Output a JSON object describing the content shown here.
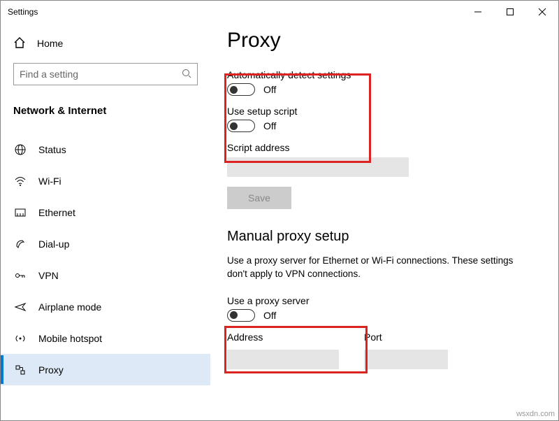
{
  "window": {
    "title": "Settings"
  },
  "sidebar": {
    "home_label": "Home",
    "search_placeholder": "Find a setting",
    "category": "Network & Internet",
    "items": [
      {
        "label": "Status"
      },
      {
        "label": "Wi-Fi"
      },
      {
        "label": "Ethernet"
      },
      {
        "label": "Dial-up"
      },
      {
        "label": "VPN"
      },
      {
        "label": "Airplane mode"
      },
      {
        "label": "Mobile hotspot"
      },
      {
        "label": "Proxy"
      }
    ]
  },
  "page": {
    "title": "Proxy",
    "auto_detect_label": "Automatically detect settings",
    "auto_detect_state": "Off",
    "use_setup_label": "Use setup script",
    "use_setup_state": "Off",
    "script_address_label": "Script address",
    "save_label": "Save",
    "manual_heading": "Manual proxy setup",
    "manual_desc": "Use a proxy server for Ethernet or Wi-Fi connections. These settings don't apply to VPN connections.",
    "use_proxy_label": "Use a proxy server",
    "use_proxy_state": "Off",
    "address_label": "Address",
    "port_label": "Port"
  },
  "watermark": "wsxdn.com"
}
